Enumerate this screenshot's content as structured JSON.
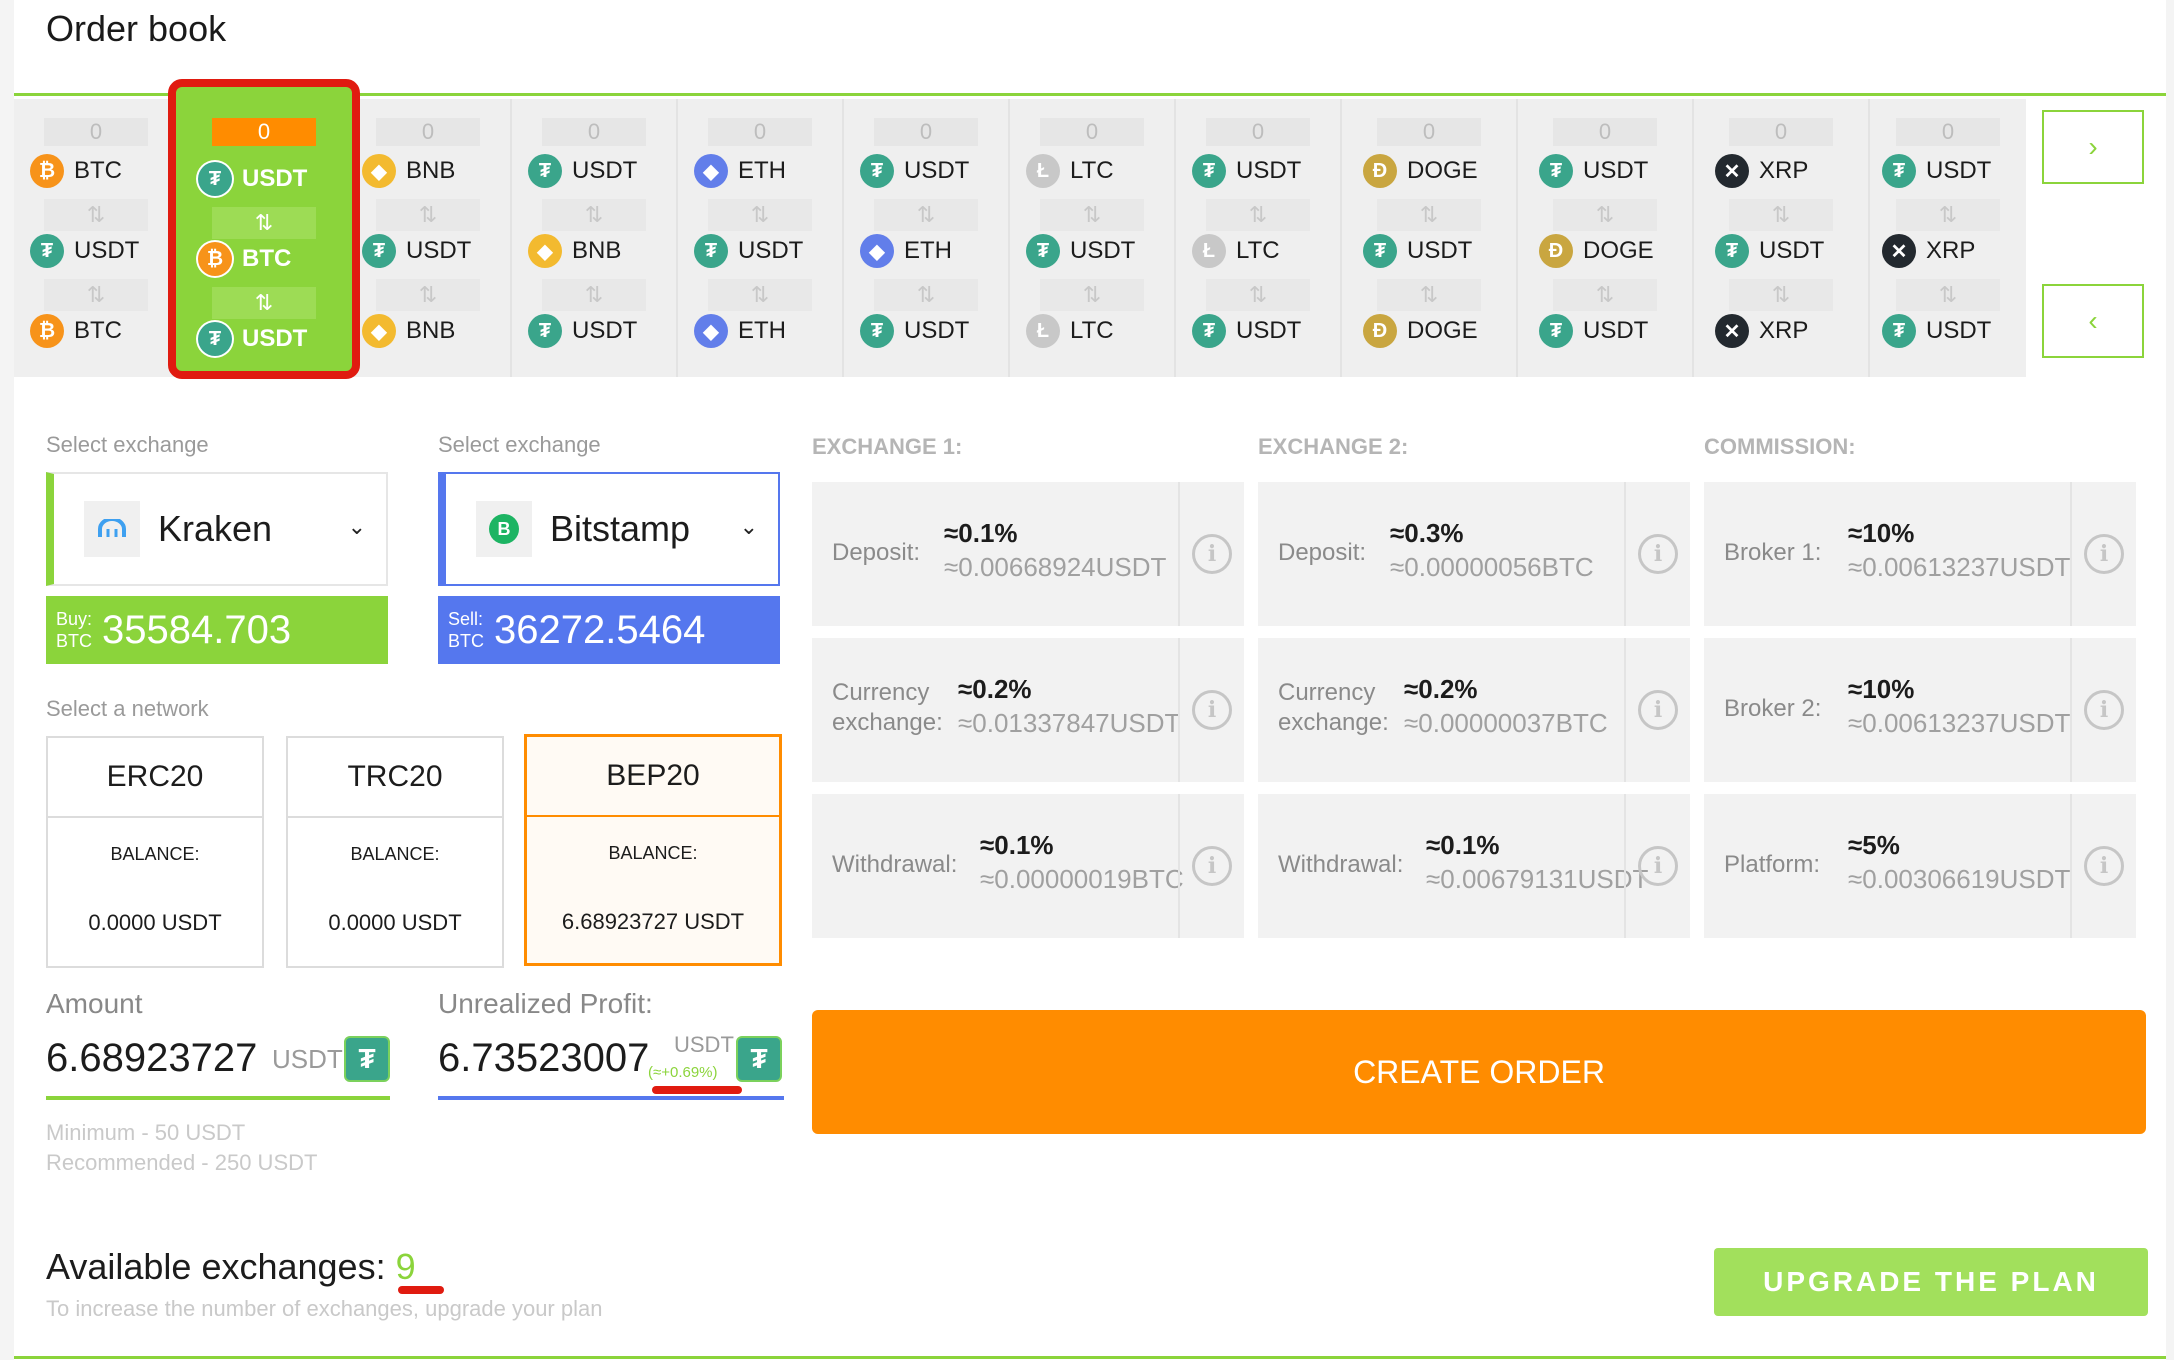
{
  "page_title": "Order book",
  "colors": {
    "accent": "#8bd43b",
    "orange": "#ff8c00",
    "blue": "#5577ee",
    "annotation": "#e01b10"
  },
  "order_book": [
    {
      "count": "0",
      "top": "BTC",
      "mid": "USDT",
      "bottom": "BTC",
      "active": false
    },
    {
      "count": "0",
      "top": "USDT",
      "mid": "BTC",
      "bottom": "USDT",
      "active": true
    },
    {
      "count": "0",
      "top": "BNB",
      "mid": "USDT",
      "bottom": "BNB",
      "active": false
    },
    {
      "count": "0",
      "top": "USDT",
      "mid": "BNB",
      "bottom": "USDT",
      "active": false
    },
    {
      "count": "0",
      "top": "ETH",
      "mid": "USDT",
      "bottom": "ETH",
      "active": false
    },
    {
      "count": "0",
      "top": "USDT",
      "mid": "ETH",
      "bottom": "USDT",
      "active": false
    },
    {
      "count": "0",
      "top": "LTC",
      "mid": "USDT",
      "bottom": "LTC",
      "active": false
    },
    {
      "count": "0",
      "top": "USDT",
      "mid": "LTC",
      "bottom": "USDT",
      "active": false
    },
    {
      "count": "0",
      "top": "DOGE",
      "mid": "USDT",
      "bottom": "DOGE",
      "active": false
    },
    {
      "count": "0",
      "top": "USDT",
      "mid": "DOGE",
      "bottom": "USDT",
      "active": false
    },
    {
      "count": "0",
      "top": "XRP",
      "mid": "USDT",
      "bottom": "XRP",
      "active": false
    },
    {
      "count": "0",
      "top": "USDT",
      "mid": "XRP",
      "bottom": "USDT",
      "active": false
    }
  ],
  "swap_symbol": "⇅",
  "nav": {
    "next": "›",
    "prev": "‹"
  },
  "exchange1": {
    "label": "Select exchange",
    "name": "Kraken",
    "price_tag_line1": "Buy:",
    "price_tag_line2": "BTC",
    "price": "35584.703"
  },
  "exchange2": {
    "label": "Select exchange",
    "name": "Bitstamp",
    "price_tag_line1": "Sell:",
    "price_tag_line2": "BTC",
    "price": "36272.5464"
  },
  "network": {
    "label": "Select a network",
    "options": [
      {
        "name": "ERC20",
        "balance_label": "BALANCE:",
        "balance": "0.0000 USDT"
      },
      {
        "name": "TRC20",
        "balance_label": "BALANCE:",
        "balance": "0.0000 USDT"
      },
      {
        "name": "BEP20",
        "balance_label": "BALANCE:",
        "balance": "6.68923727 USDT",
        "selected": true
      }
    ]
  },
  "amount": {
    "label": "Amount",
    "value": "6.68923727",
    "unit": "USDT",
    "min": "Minimum - 50 USDT",
    "recommended": "Recommended - 250 USDT"
  },
  "profit": {
    "label": "Unrealized Profit:",
    "value": "6.73523007",
    "unit": "USDT",
    "pct": "(≈+0.69%)"
  },
  "fees": {
    "exchange1": {
      "header": "EXCHANGE 1:",
      "items": [
        {
          "name": "Deposit:",
          "name2": "",
          "pct": "≈0.1%",
          "amount": "≈0.00668924USDT"
        },
        {
          "name": "Currency",
          "name2": "exchange:",
          "pct": "≈0.2%",
          "amount": "≈0.01337847USDT"
        },
        {
          "name": "Withdrawal:",
          "name2": "",
          "pct": "≈0.1%",
          "amount": "≈0.00000019BTC"
        }
      ]
    },
    "exchange2": {
      "header": "EXCHANGE 2:",
      "items": [
        {
          "name": "Deposit:",
          "name2": "",
          "pct": "≈0.3%",
          "amount": "≈0.00000056BTC"
        },
        {
          "name": "Currency",
          "name2": "exchange:",
          "pct": "≈0.2%",
          "amount": "≈0.00000037BTC"
        },
        {
          "name": "Withdrawal:",
          "name2": "",
          "pct": "≈0.1%",
          "amount": "≈0.00679131USDT"
        }
      ]
    },
    "commission": {
      "header": "COMMISSION:",
      "items": [
        {
          "name": "Broker 1:",
          "name2": "",
          "pct": "≈10%",
          "amount": "≈0.00613237USDT"
        },
        {
          "name": "Broker 2:",
          "name2": "",
          "pct": "≈10%",
          "amount": "≈0.00613237USDT"
        },
        {
          "name": "Platform:",
          "name2": "",
          "pct": "≈5%",
          "amount": "≈0.00306619USDT"
        }
      ]
    }
  },
  "create_order": "CREATE ORDER",
  "available": {
    "label": "Available exchanges:",
    "count": "9",
    "hint": "To increase the number of exchanges, upgrade your plan"
  },
  "upgrade": "UPGRADE THE PLAN"
}
